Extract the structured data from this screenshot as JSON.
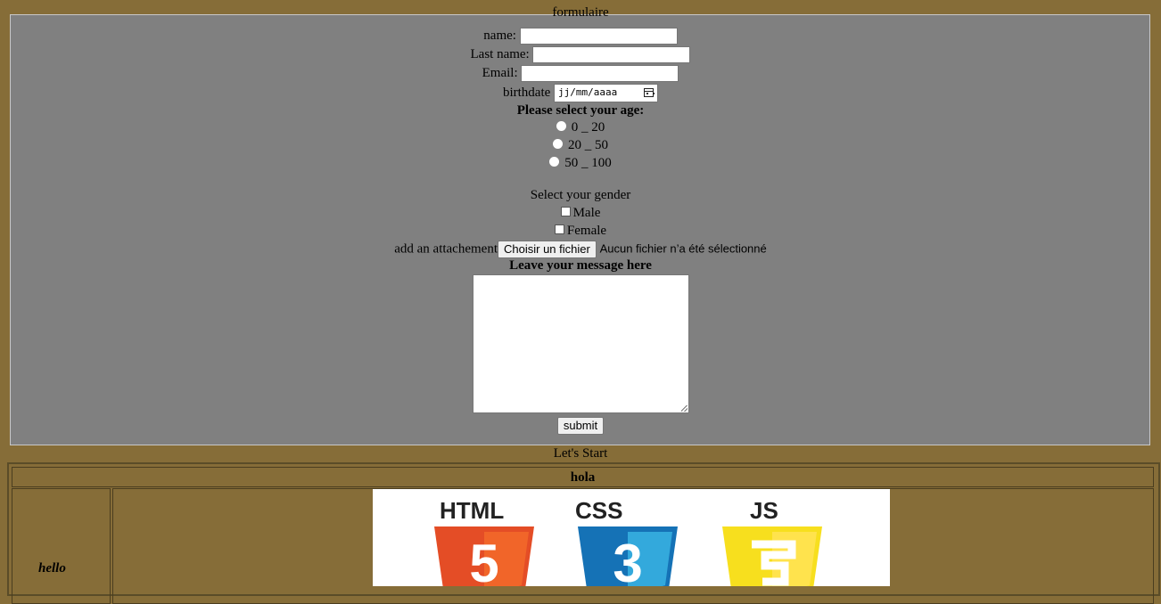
{
  "form": {
    "legend": "formulaire",
    "name_label": "name:",
    "lastname_label": "Last name:",
    "email_label": "Email:",
    "birthdate_label": "birthdate",
    "birthdate_placeholder": "jj/mm/aaaa",
    "age_title": "Please select your age:",
    "age_options": [
      "0 _ 20",
      "20 _ 50",
      "50 _ 100"
    ],
    "gender_title": "Select your gender",
    "gender_options": [
      "Male",
      "Female"
    ],
    "attachment_label": "add an attachement",
    "file_button": "Choisir un fichier",
    "file_status": "Aucun fichier n’a été sélectionné",
    "message_title": "Leave your message here",
    "submit": "submit"
  },
  "section_caption": "Let's Start",
  "table": {
    "header": "hola",
    "cell_label": "hello",
    "logos": [
      {
        "label": "HTML",
        "digit": "5",
        "color": "#e44d26"
      },
      {
        "label": "CSS",
        "digit": "3",
        "color": "#1572b6"
      },
      {
        "label": "JS",
        "digit": "",
        "color": "#f7df1e"
      }
    ]
  }
}
